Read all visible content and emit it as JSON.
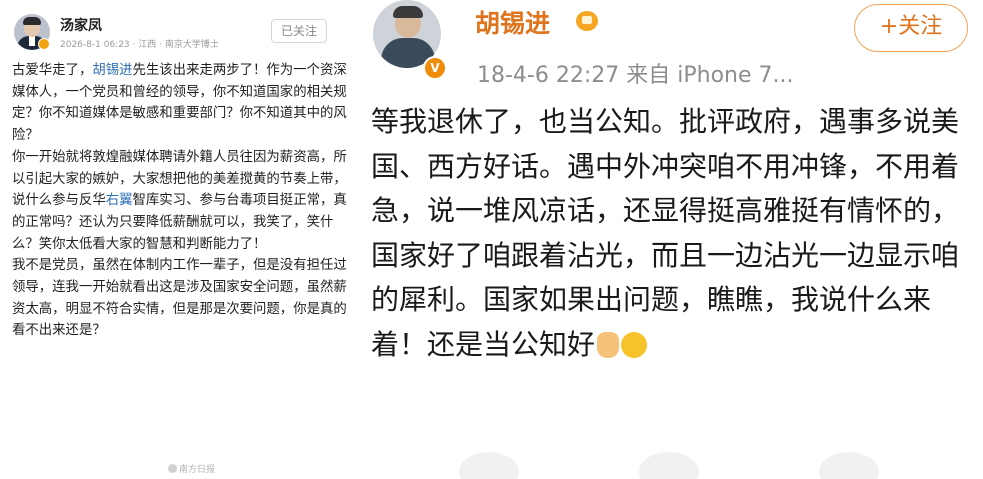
{
  "left_post": {
    "author": "汤家凤",
    "meta": "2026-8-1 06:23 · 江西 · 南京大学博士",
    "follow_label": "已关注",
    "paragraphs": [
      {
        "segments": [
          {
            "text": "古爱华走了，",
            "link": false
          },
          {
            "text": "胡锡进",
            "link": true
          },
          {
            "text": "先生该出来走两步了！作为一个资深媒体人，一个党员和曾经的领导，你不知道国家的相关规定？你不知道媒体是敏感和重要部门？你不知道其中的风险？",
            "link": false
          }
        ]
      },
      {
        "segments": [
          {
            "text": "你一开始就将敦煌融媒体聘请外籍人员往因为薪资高，所以引起大家的嫉妒，大家想把他的美差搅黄的节奏上带，说什么参与反华",
            "link": false
          },
          {
            "text": "右翼",
            "link": true
          },
          {
            "text": "智库实习、参与台毒项目挺正常，真的正常吗？还认为只要降低薪酬就可以，我笑了，笑什么？笑你太低看大家的智慧和判断能力了！",
            "link": false
          }
        ]
      },
      {
        "segments": [
          {
            "text": "我不是党员，虽然在体制内工作一辈子，但是没有担任过领导，连我一开始就看出这是涉及国家安全问题，虽然薪资太高，明显不符合实情，但是那是次要问题，你是真的看不出来还是？",
            "link": false
          }
        ]
      }
    ],
    "watermark": "南方日报"
  },
  "right_post": {
    "author": "胡锡进",
    "meta": "18-4-6 22:27  来自 iPhone 7...",
    "follow_label": "+关注",
    "body": "等我退休了，也当公知。批评政府，遇事多说美国、西方好话。遇中外冲突咱不用冲锋，不用着急，说一堆风凉话，还显得挺高雅挺有情怀的，国家好了咱跟着沾光，而且一边沾光一边显示咱的犀利。国家如果出问题，瞧瞧，我说什么来着！还是当公知好",
    "emojis": [
      "thumbs-up-emoji",
      "smile-emoji"
    ]
  }
}
